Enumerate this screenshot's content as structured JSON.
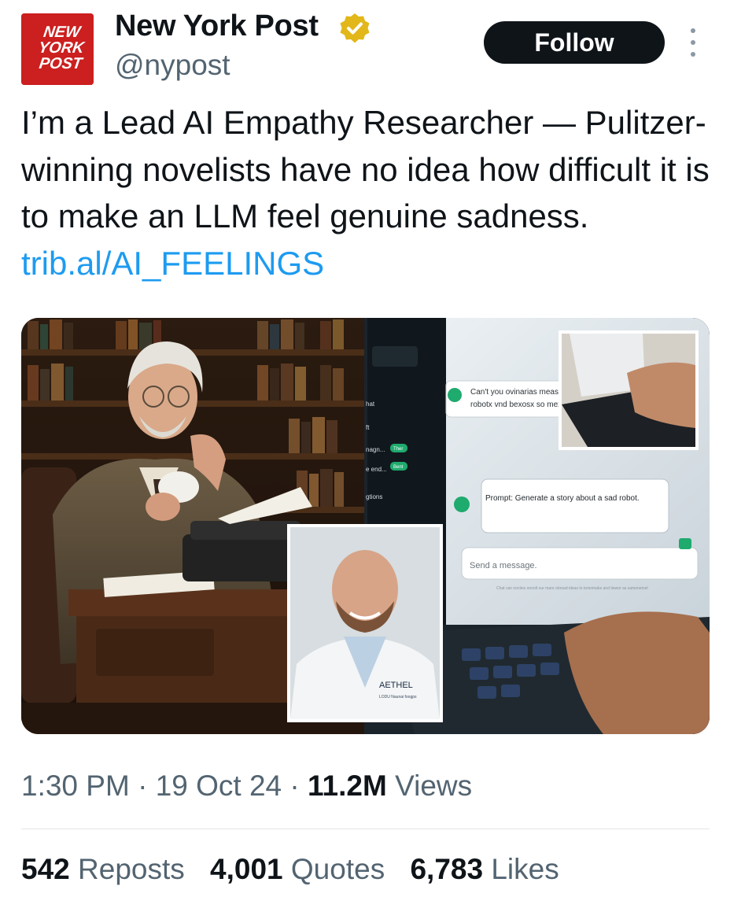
{
  "account": {
    "name": "New York Post",
    "handle": "@nypost",
    "logo_lines": [
      "NEW",
      "YORK",
      "POST"
    ],
    "verified_icon": "gold-verified-badge-icon",
    "logo_color": "#cc1f1f"
  },
  "follow_label": "Follow",
  "more_icon": "vertical-ellipsis-icon",
  "tweet": {
    "text": "I’m a Lead AI Empathy Researcher — Pulitzer-winning novelists have no idea how difficult it is to make an LLM feel genuine sadness.",
    "link": "trib.al/AI_FEELINGS",
    "link_color": "#1d9bf0"
  },
  "media": {
    "chat_messages": [
      "Can't you ovinarias meas",
      "robotx vnd bexosx so mexe"
    ],
    "prompt_text": "Prompt: Generate a story about a sad robot.",
    "send_placeholder": "Send a message.",
    "disclaimer": "Chat can nocties onnolt our mare obroad ideas to tomomake and tiewor as samenemel",
    "sidebar_items": [
      "hat",
      "ft",
      "nagn...",
      "e end...",
      "gtions"
    ],
    "sidebar_badges": [
      "Ther",
      "Bent"
    ],
    "badge_text": "AETHEL",
    "badge_subtext": "LODU Naunai foogps"
  },
  "timestamp": {
    "time": "1:30 PM",
    "date": "19 Oct 24",
    "views_count": "11.2M",
    "views_label": "Views",
    "separator": "·"
  },
  "stats": {
    "reposts_count": "542",
    "reposts_label": "Reposts",
    "quotes_count": "4,001",
    "quotes_label": "Quotes",
    "likes_count": "6,783",
    "likes_label": "Likes"
  }
}
